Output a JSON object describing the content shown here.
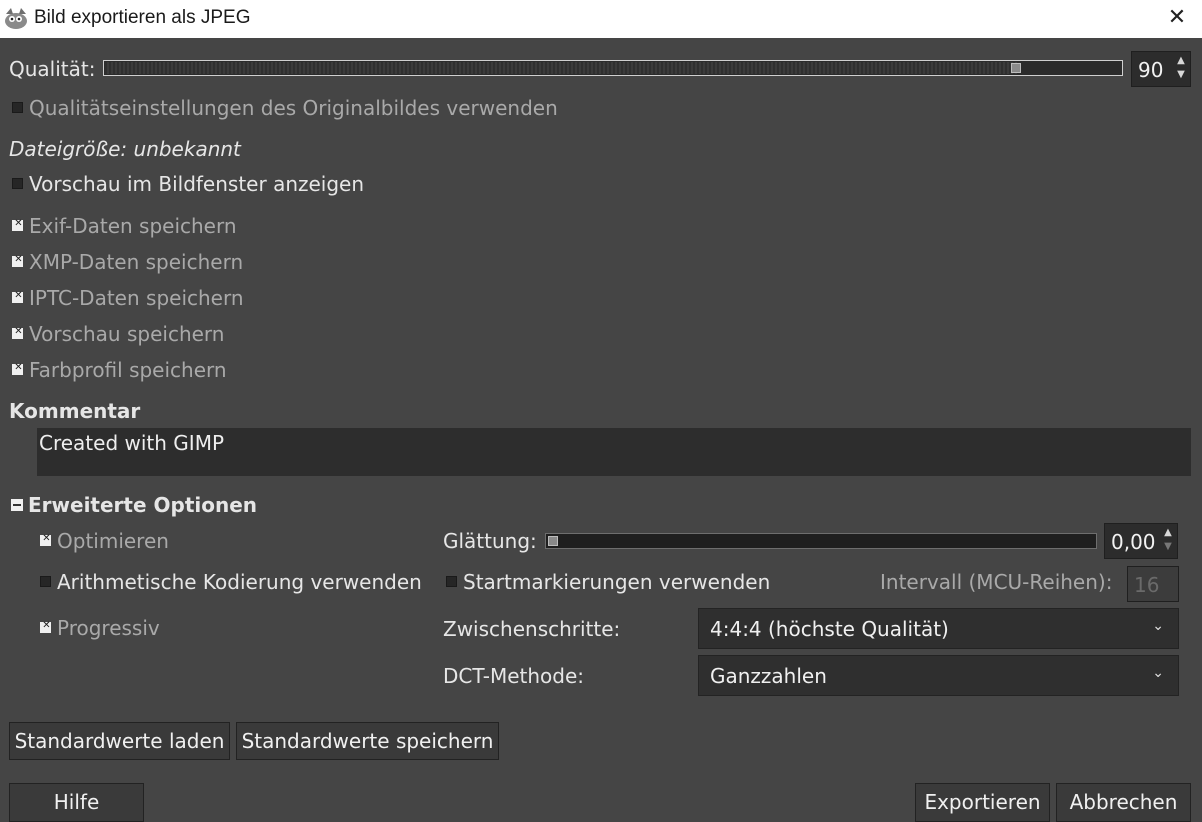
{
  "window": {
    "title": "Bild exportieren als JPEG",
    "close_symbol": "✕",
    "app_icon": "gimp-icon"
  },
  "quality": {
    "label": "Qualität:",
    "value": "90",
    "fraction": 0.9
  },
  "checkboxes": {
    "orig_quality": {
      "label": "Qualitätseinstellungen des Originalbildes verwenden",
      "checked": false
    },
    "preview_window": {
      "label": "Vorschau im Bildfenster anzeigen",
      "checked": false
    },
    "exif": {
      "label": "Exif-Daten speichern",
      "checked": true
    },
    "xmp": {
      "label": "XMP-Daten speichern",
      "checked": true
    },
    "iptc": {
      "label": "IPTC-Daten speichern",
      "checked": true
    },
    "thumbnail": {
      "label": "Vorschau speichern",
      "checked": true
    },
    "color_profile": {
      "label": "Farbprofil speichern",
      "checked": true
    }
  },
  "filesize": {
    "label": "Dateigröße: unbekannt"
  },
  "comment": {
    "heading": "Kommentar",
    "text": "Created with GIMP"
  },
  "advanced": {
    "heading": "Erweiterte Optionen",
    "optimize": {
      "label": "Optimieren",
      "checked": true
    },
    "arithmetic": {
      "label": "Arithmetische Kodierung verwenden",
      "checked": false
    },
    "progressive": {
      "label": "Progressiv",
      "checked": true
    },
    "smoothing": {
      "label": "Glättung:",
      "value": "0,00",
      "fraction": 0.0
    },
    "restart": {
      "label": "Startmarkierungen verwenden",
      "checked": false
    },
    "interval": {
      "label": "Intervall (MCU-Reihen):",
      "value": "16"
    },
    "subsampling": {
      "label": "Zwischenschritte:",
      "value": "4:4:4 (höchste Qualität)"
    },
    "dct": {
      "label": "DCT-Methode:",
      "value": "Ganzzahlen"
    }
  },
  "buttons": {
    "load_defaults": "Standardwerte laden",
    "save_defaults": "Standardwerte speichern",
    "help": "Hilfe",
    "export": "Exportieren",
    "cancel": "Abbrechen"
  },
  "icons": {
    "spin_up": "▲",
    "spin_down": "▼",
    "chevron": "⌄"
  }
}
